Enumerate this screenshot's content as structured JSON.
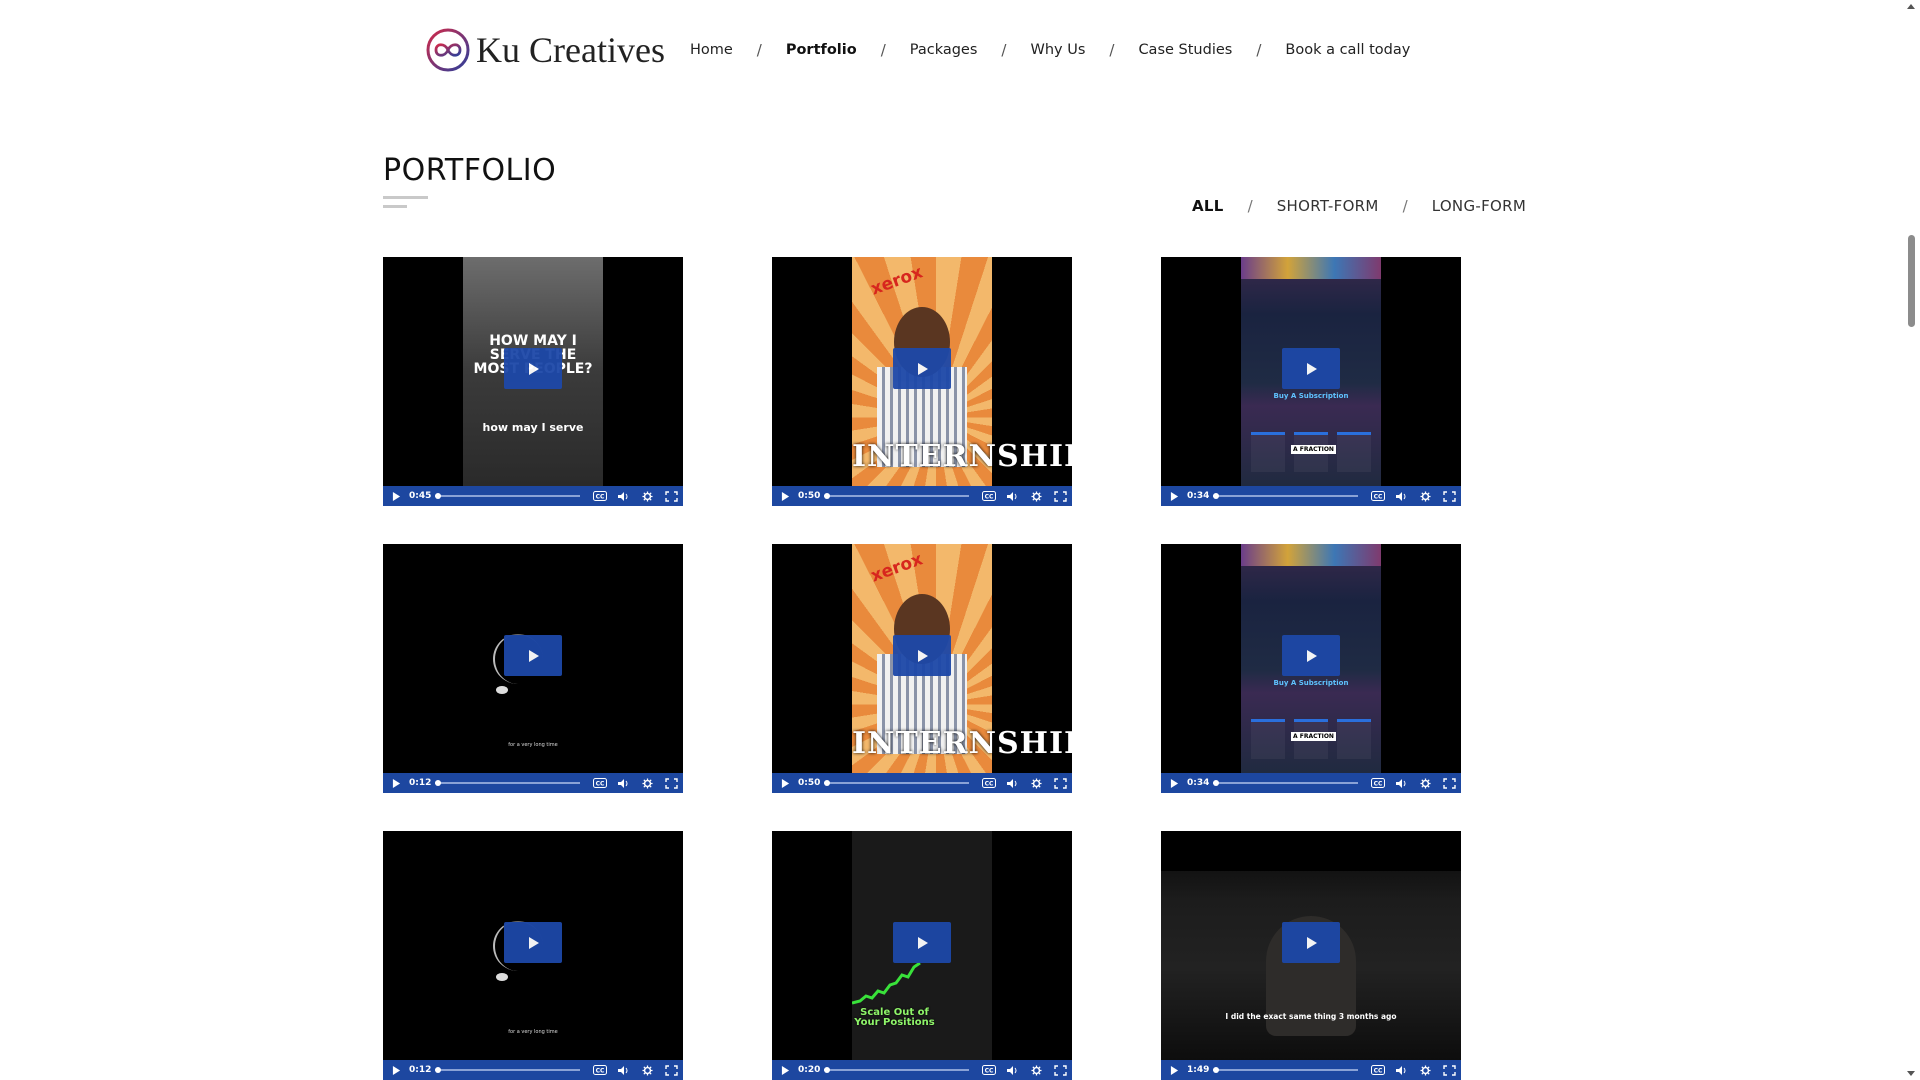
{
  "brand": {
    "name": "Ku Creatives",
    "logo_color_a": "#d12a4a",
    "logo_color_b": "#2b3f9b"
  },
  "nav": {
    "items": [
      {
        "label": "Home",
        "active": false
      },
      {
        "label": "Portfolio",
        "active": true
      },
      {
        "label": "Packages",
        "active": false
      },
      {
        "label": "Why Us",
        "active": false
      },
      {
        "label": "Case Studies",
        "active": false
      },
      {
        "label": "Book a call today",
        "active": false
      }
    ],
    "separator": "/"
  },
  "page": {
    "title": "PORTFOLIO"
  },
  "filters": {
    "items": [
      {
        "label": "ALL",
        "active": true
      },
      {
        "label": "SHORT-FORM",
        "active": false
      },
      {
        "label": "LONG-FORM",
        "active": false
      }
    ],
    "separator": "/"
  },
  "player": {
    "accent_color": "#1d47a0"
  },
  "videos": [
    {
      "time": "0:45",
      "thumb": "crowd",
      "text_main": "HOW MAY I SERVE THE MOST PEOPLE?",
      "text_sub": "how may I serve"
    },
    {
      "time": "0:50",
      "thumb": "xerox",
      "text_main": "xerox",
      "text_sub": "INTERNSHIP"
    },
    {
      "time": "0:34",
      "thumb": "site",
      "text_main": "Buy A Subscription",
      "text_sub": "A FRACTION"
    },
    {
      "time": "0:12",
      "thumb": "spinner",
      "text_main": "",
      "text_sub": "for a very long time"
    },
    {
      "time": "0:50",
      "thumb": "xerox",
      "text_main": "xerox",
      "text_sub": "INTERNSHIP"
    },
    {
      "time": "0:34",
      "thumb": "site",
      "text_main": "Buy A Subscription",
      "text_sub": "A FRACTION"
    },
    {
      "time": "0:12",
      "thumb": "spinner",
      "text_main": "",
      "text_sub": "for a very long time"
    },
    {
      "time": "0:20",
      "thumb": "trade",
      "text_main": "Scale Out of Your Positions",
      "text_sub": ""
    },
    {
      "time": "1:49",
      "thumb": "room",
      "text_main": "",
      "text_sub": "I did the exact same thing 3 months ago"
    }
  ]
}
